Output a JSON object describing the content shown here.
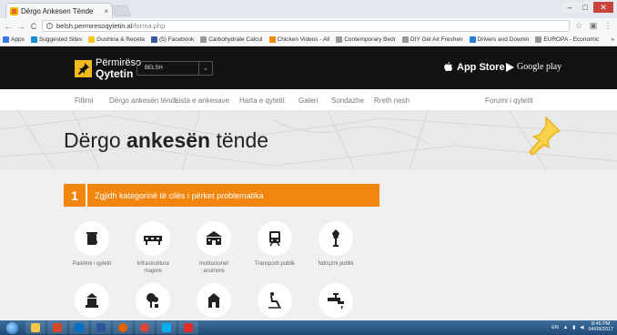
{
  "browser": {
    "tab_title": "Dërgo Ankesen Tënde",
    "tab_close": "×",
    "url_host": "belsh.permiresoqytetin.al",
    "url_path": "/forma.php",
    "bookmarks": [
      {
        "label": "Apps",
        "color": "#3b78e7"
      },
      {
        "label": "Suggested Sites",
        "color": "#1a8fd1"
      },
      {
        "label": "Gushina & Receta",
        "color": "#f5c518"
      },
      {
        "label": "(5) Facebook",
        "color": "#3b5998"
      },
      {
        "label": "Carbohydrate Calcul",
        "color": "#999999"
      },
      {
        "label": "Chicken Videos - All",
        "color": "#f08a00"
      },
      {
        "label": "Contemporary Bedr",
        "color": "#999999"
      },
      {
        "label": "DIY Gel Air Freshen",
        "color": "#999999"
      },
      {
        "label": "Drivers and Downlo",
        "color": "#2b7bd6"
      },
      {
        "label": "EUROPA - Economic",
        "color": "#999999"
      }
    ],
    "more_bookmarks": "»"
  },
  "header": {
    "logo_line1": "Përmirëso",
    "logo_line2": "Qytetin",
    "city_value": "BELSH",
    "appstore_label": "App Store",
    "googleplay_label": "Google play"
  },
  "nav": {
    "items": [
      "Fillimi",
      "Dërgo ankesën tënde",
      "Lista e ankesave",
      "Harta e qytetit",
      "Galeri",
      "Sondazhe",
      "Rreth nesh"
    ],
    "forum": "Forumi i qytetit"
  },
  "hero": {
    "title_part1": "Dërgo ",
    "title_bold": "ankesën",
    "title_part2": " tënde"
  },
  "step": {
    "number": "1",
    "label": "Zgjidh kategorinë të cilës i përket problematika"
  },
  "categories": [
    {
      "label": "Pastrimi i qytetit",
      "icon": "trash-bin-icon"
    },
    {
      "label": "Infrastruktura rrugore",
      "icon": "road-barrier-icon"
    },
    {
      "label": "Institucionet arsimore",
      "icon": "school-icon"
    },
    {
      "label": "Transporti publik",
      "icon": "train-icon"
    },
    {
      "label": "Ndriçimi publik",
      "icon": "street-lamp-icon"
    },
    {
      "label": "",
      "icon": "building-icon"
    },
    {
      "label": "",
      "icon": "tree-icon"
    },
    {
      "label": "",
      "icon": "family-icon"
    },
    {
      "label": "",
      "icon": "disabled-ramp-icon"
    },
    {
      "label": "",
      "icon": "water-tap-icon"
    }
  ],
  "taskbar": {
    "lang": "EN",
    "time": "8:45 PM",
    "date": "04/09/2017"
  },
  "colors": {
    "accent_orange": "#f2850d",
    "logo_yellow": "#f2b91c",
    "header_black": "#121212"
  }
}
